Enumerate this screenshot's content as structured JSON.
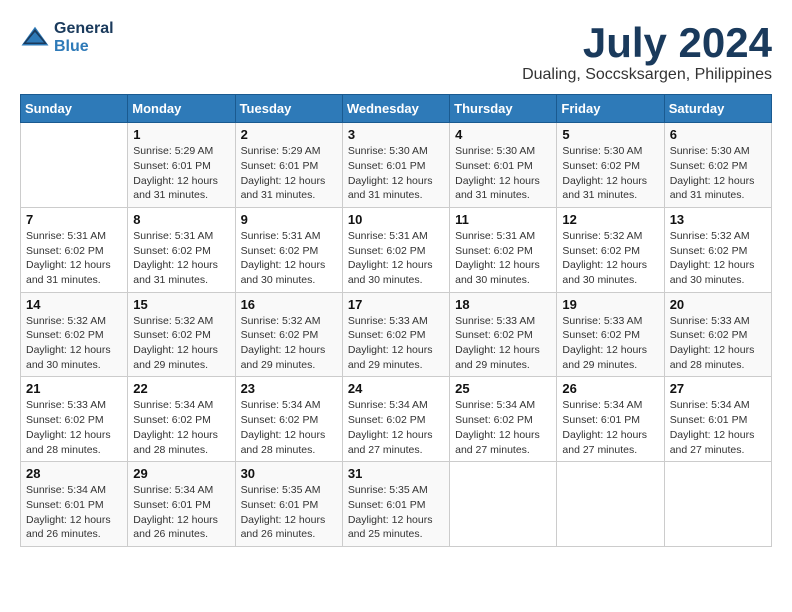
{
  "logo": {
    "text_general": "General",
    "text_blue": "Blue"
  },
  "title": "July 2024",
  "location": "Dualing, Soccsksargen, Philippines",
  "days_header": [
    "Sunday",
    "Monday",
    "Tuesday",
    "Wednesday",
    "Thursday",
    "Friday",
    "Saturday"
  ],
  "weeks": [
    [
      {
        "day": "",
        "info": ""
      },
      {
        "day": "1",
        "info": "Sunrise: 5:29 AM\nSunset: 6:01 PM\nDaylight: 12 hours\nand 31 minutes."
      },
      {
        "day": "2",
        "info": "Sunrise: 5:29 AM\nSunset: 6:01 PM\nDaylight: 12 hours\nand 31 minutes."
      },
      {
        "day": "3",
        "info": "Sunrise: 5:30 AM\nSunset: 6:01 PM\nDaylight: 12 hours\nand 31 minutes."
      },
      {
        "day": "4",
        "info": "Sunrise: 5:30 AM\nSunset: 6:01 PM\nDaylight: 12 hours\nand 31 minutes."
      },
      {
        "day": "5",
        "info": "Sunrise: 5:30 AM\nSunset: 6:02 PM\nDaylight: 12 hours\nand 31 minutes."
      },
      {
        "day": "6",
        "info": "Sunrise: 5:30 AM\nSunset: 6:02 PM\nDaylight: 12 hours\nand 31 minutes."
      }
    ],
    [
      {
        "day": "7",
        "info": "Sunrise: 5:31 AM\nSunset: 6:02 PM\nDaylight: 12 hours\nand 31 minutes."
      },
      {
        "day": "8",
        "info": "Sunrise: 5:31 AM\nSunset: 6:02 PM\nDaylight: 12 hours\nand 31 minutes."
      },
      {
        "day": "9",
        "info": "Sunrise: 5:31 AM\nSunset: 6:02 PM\nDaylight: 12 hours\nand 30 minutes."
      },
      {
        "day": "10",
        "info": "Sunrise: 5:31 AM\nSunset: 6:02 PM\nDaylight: 12 hours\nand 30 minutes."
      },
      {
        "day": "11",
        "info": "Sunrise: 5:31 AM\nSunset: 6:02 PM\nDaylight: 12 hours\nand 30 minutes."
      },
      {
        "day": "12",
        "info": "Sunrise: 5:32 AM\nSunset: 6:02 PM\nDaylight: 12 hours\nand 30 minutes."
      },
      {
        "day": "13",
        "info": "Sunrise: 5:32 AM\nSunset: 6:02 PM\nDaylight: 12 hours\nand 30 minutes."
      }
    ],
    [
      {
        "day": "14",
        "info": "Sunrise: 5:32 AM\nSunset: 6:02 PM\nDaylight: 12 hours\nand 30 minutes."
      },
      {
        "day": "15",
        "info": "Sunrise: 5:32 AM\nSunset: 6:02 PM\nDaylight: 12 hours\nand 29 minutes."
      },
      {
        "day": "16",
        "info": "Sunrise: 5:32 AM\nSunset: 6:02 PM\nDaylight: 12 hours\nand 29 minutes."
      },
      {
        "day": "17",
        "info": "Sunrise: 5:33 AM\nSunset: 6:02 PM\nDaylight: 12 hours\nand 29 minutes."
      },
      {
        "day": "18",
        "info": "Sunrise: 5:33 AM\nSunset: 6:02 PM\nDaylight: 12 hours\nand 29 minutes."
      },
      {
        "day": "19",
        "info": "Sunrise: 5:33 AM\nSunset: 6:02 PM\nDaylight: 12 hours\nand 29 minutes."
      },
      {
        "day": "20",
        "info": "Sunrise: 5:33 AM\nSunset: 6:02 PM\nDaylight: 12 hours\nand 28 minutes."
      }
    ],
    [
      {
        "day": "21",
        "info": "Sunrise: 5:33 AM\nSunset: 6:02 PM\nDaylight: 12 hours\nand 28 minutes."
      },
      {
        "day": "22",
        "info": "Sunrise: 5:34 AM\nSunset: 6:02 PM\nDaylight: 12 hours\nand 28 minutes."
      },
      {
        "day": "23",
        "info": "Sunrise: 5:34 AM\nSunset: 6:02 PM\nDaylight: 12 hours\nand 28 minutes."
      },
      {
        "day": "24",
        "info": "Sunrise: 5:34 AM\nSunset: 6:02 PM\nDaylight: 12 hours\nand 27 minutes."
      },
      {
        "day": "25",
        "info": "Sunrise: 5:34 AM\nSunset: 6:02 PM\nDaylight: 12 hours\nand 27 minutes."
      },
      {
        "day": "26",
        "info": "Sunrise: 5:34 AM\nSunset: 6:01 PM\nDaylight: 12 hours\nand 27 minutes."
      },
      {
        "day": "27",
        "info": "Sunrise: 5:34 AM\nSunset: 6:01 PM\nDaylight: 12 hours\nand 27 minutes."
      }
    ],
    [
      {
        "day": "28",
        "info": "Sunrise: 5:34 AM\nSunset: 6:01 PM\nDaylight: 12 hours\nand 26 minutes."
      },
      {
        "day": "29",
        "info": "Sunrise: 5:34 AM\nSunset: 6:01 PM\nDaylight: 12 hours\nand 26 minutes."
      },
      {
        "day": "30",
        "info": "Sunrise: 5:35 AM\nSunset: 6:01 PM\nDaylight: 12 hours\nand 26 minutes."
      },
      {
        "day": "31",
        "info": "Sunrise: 5:35 AM\nSunset: 6:01 PM\nDaylight: 12 hours\nand 25 minutes."
      },
      {
        "day": "",
        "info": ""
      },
      {
        "day": "",
        "info": ""
      },
      {
        "day": "",
        "info": ""
      }
    ]
  ]
}
